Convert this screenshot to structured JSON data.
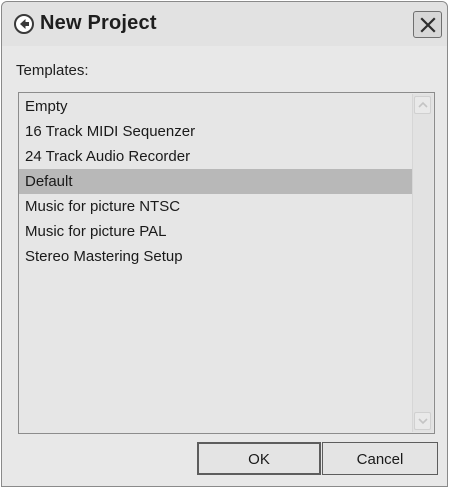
{
  "window": {
    "title": "New Project",
    "icon": "back-arrow-app-icon",
    "close_icon": "close-icon"
  },
  "templates": {
    "label": "Templates:",
    "items": [
      {
        "label": "Empty",
        "selected": false
      },
      {
        "label": "16 Track MIDI Sequenzer",
        "selected": false
      },
      {
        "label": "24 Track Audio Recorder",
        "selected": false
      },
      {
        "label": "Default",
        "selected": true
      },
      {
        "label": "Music for picture NTSC",
        "selected": false
      },
      {
        "label": "Music for picture PAL",
        "selected": false
      },
      {
        "label": "Stereo Mastering Setup",
        "selected": false
      }
    ]
  },
  "buttons": {
    "ok_label": "OK",
    "cancel_label": "Cancel"
  },
  "colors": {
    "selection": "#b8b8b8",
    "dialog_bg": "#e8e8e8"
  }
}
